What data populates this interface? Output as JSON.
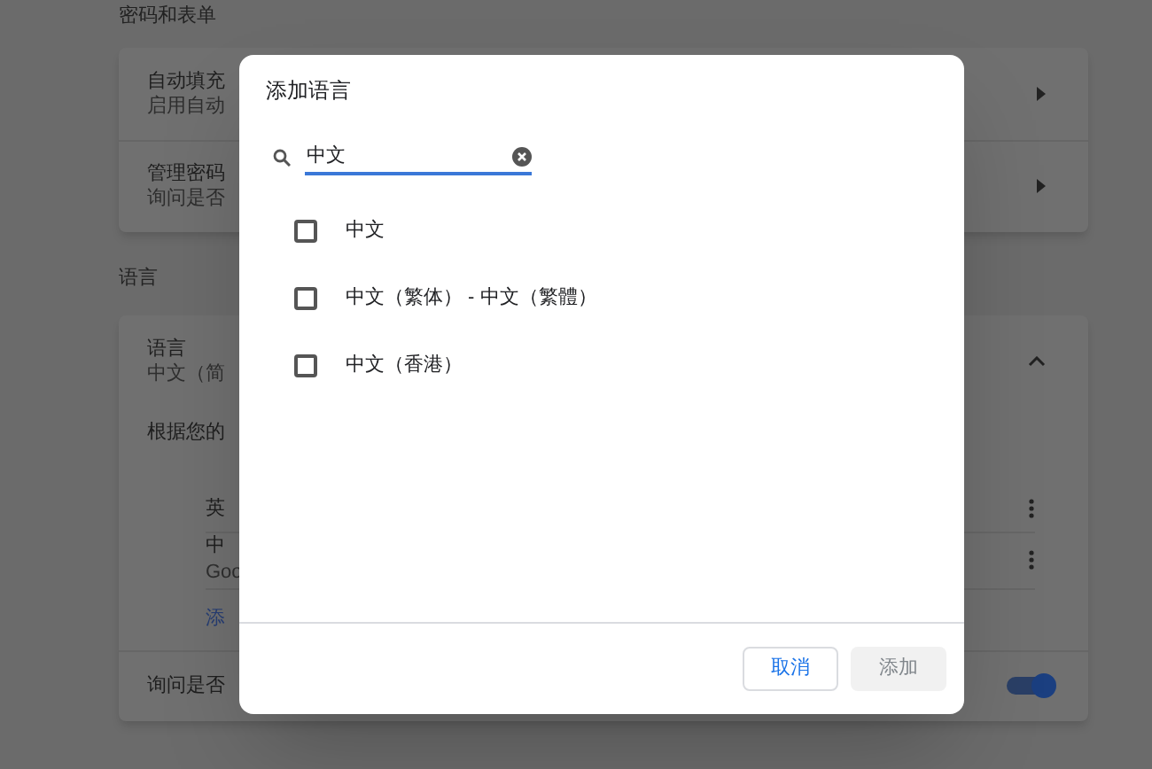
{
  "background": {
    "sections": [
      {
        "title": "密码和表单",
        "rows": [
          {
            "title": "自动填充",
            "subtitle": "启用自动",
            "kind": "chevron"
          },
          {
            "title": "管理密码",
            "subtitle": "询问是否",
            "kind": "chevron"
          }
        ]
      },
      {
        "title": "语言",
        "rows": [
          {
            "title": "语言",
            "subtitle": "中文（简",
            "kind": "collapse"
          }
        ]
      }
    ],
    "languages": {
      "intro": "根据您的",
      "items": [
        {
          "name": "英"
        },
        {
          "name": "中",
          "note": "Goo"
        }
      ],
      "add_link": "添"
    },
    "translate_row": {
      "label": "询问是否",
      "on": true
    }
  },
  "dialog": {
    "title": "添加语言",
    "search": {
      "value": "中文"
    },
    "options": [
      {
        "label": "中文",
        "checked": false
      },
      {
        "label": "中文（繁体） - 中文（繁體）",
        "checked": false
      },
      {
        "label": "中文（香港）",
        "checked": false
      }
    ],
    "buttons": [
      {
        "label": "取消",
        "disabled": false
      },
      {
        "label": "添加",
        "disabled": true
      }
    ]
  }
}
